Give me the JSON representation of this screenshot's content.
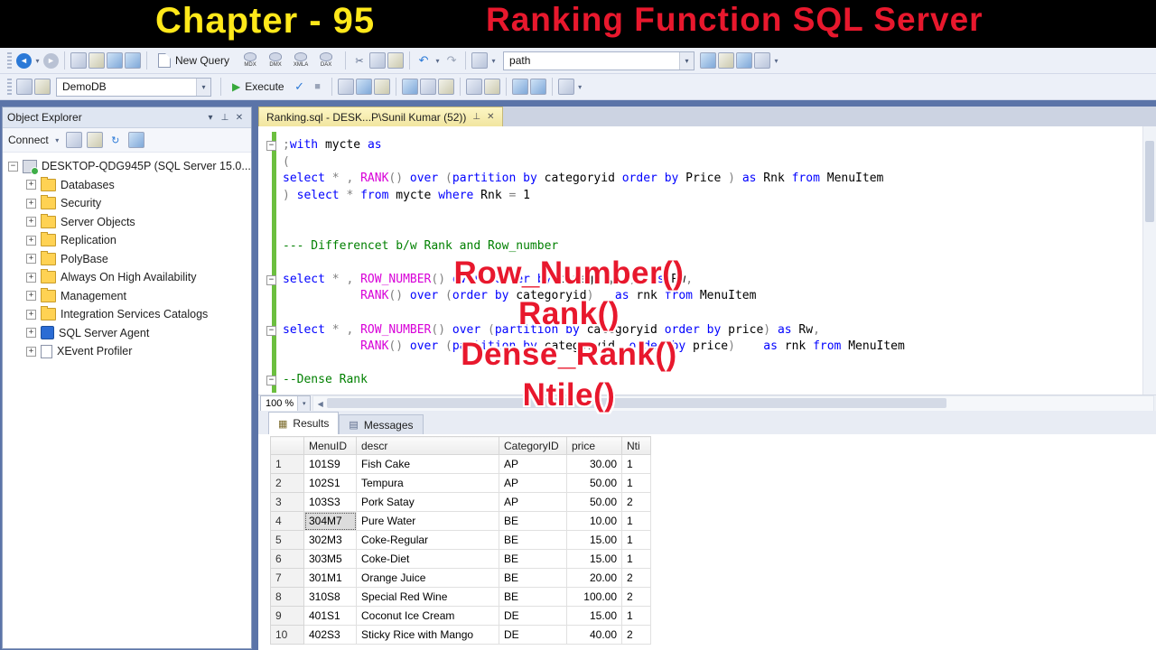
{
  "banner": {
    "chapter": "Chapter - 95",
    "title": "Ranking Function SQL Server",
    "chapter_color": "#ffe81a",
    "title_color": "#e8182d"
  },
  "toolbar": {
    "new_query_label": "New Query",
    "query_type_labels": [
      "MDX",
      "DMX",
      "XMLA",
      "DAX"
    ],
    "path_value": "path",
    "database_value": "DemoDB",
    "execute_label": "Execute"
  },
  "icons": {
    "back": "◄",
    "forward": "►",
    "dropdown": "▾",
    "cut": "✂",
    "undo": "↶",
    "redo": "↷",
    "refresh": "↻",
    "check": "✓",
    "stop": "■",
    "execute": "▶",
    "close": "✕",
    "pin": "⊥",
    "scroll_left": "◀",
    "results_grid": "▦",
    "messages": "▤",
    "expand_plus": "+",
    "expand_minus": "−",
    "fold_minus": "−",
    "menu_chev": "▾"
  },
  "object_explorer": {
    "title": "Object Explorer",
    "connect_label": "Connect",
    "root_label": "DESKTOP-QDG945P (SQL Server 15.0...",
    "items": [
      {
        "label": "Databases",
        "icon": "folder"
      },
      {
        "label": "Security",
        "icon": "folder"
      },
      {
        "label": "Server Objects",
        "icon": "folder"
      },
      {
        "label": "Replication",
        "icon": "folder"
      },
      {
        "label": "PolyBase",
        "icon": "folder"
      },
      {
        "label": "Always On High Availability",
        "icon": "folder"
      },
      {
        "label": "Management",
        "icon": "folder"
      },
      {
        "label": "Integration Services Catalogs",
        "icon": "folder"
      },
      {
        "label": "SQL Server Agent",
        "icon": "agent"
      },
      {
        "label": "XEvent Profiler",
        "icon": "profiler"
      }
    ]
  },
  "editor": {
    "tab_title": "Ranking.sql - DESK...P\\Sunil Kumar (52))",
    "zoom_value": "100 %",
    "code_lines": [
      {
        "fold": true,
        "tokens": [
          [
            "o",
            ";"
          ],
          [
            "k",
            "with"
          ],
          [
            "t",
            " mycte "
          ],
          [
            "k",
            "as"
          ]
        ]
      },
      {
        "tokens": [
          [
            "o",
            "("
          ]
        ]
      },
      {
        "tokens": [
          [
            "k",
            "select"
          ],
          [
            "o",
            " * , "
          ],
          [
            "f",
            "RANK"
          ],
          [
            "o",
            "() "
          ],
          [
            "k",
            "over"
          ],
          [
            "o",
            " ("
          ],
          [
            "k",
            "partition"
          ],
          [
            "t",
            " "
          ],
          [
            "k",
            "by"
          ],
          [
            "t",
            " categoryid "
          ],
          [
            "k",
            "order"
          ],
          [
            "t",
            " "
          ],
          [
            "k",
            "by"
          ],
          [
            "t",
            " Price "
          ],
          [
            "o",
            ") "
          ],
          [
            "k",
            "as"
          ],
          [
            "t",
            " Rnk "
          ],
          [
            "k",
            "from"
          ],
          [
            "t",
            " MenuItem"
          ]
        ]
      },
      {
        "tokens": [
          [
            "o",
            ") "
          ],
          [
            "k",
            "select"
          ],
          [
            "o",
            " * "
          ],
          [
            "k",
            "from"
          ],
          [
            "t",
            " mycte "
          ],
          [
            "k",
            "where"
          ],
          [
            "t",
            " Rnk "
          ],
          [
            "o",
            "= "
          ],
          [
            "t",
            "1"
          ]
        ]
      },
      {
        "tokens": []
      },
      {
        "tokens": []
      },
      {
        "tokens": [
          [
            "c",
            "--- Differencet b/w Rank and Row_number"
          ]
        ]
      },
      {
        "tokens": []
      },
      {
        "fold": true,
        "tokens": [
          [
            "k",
            "select"
          ],
          [
            "o",
            " * , "
          ],
          [
            "f",
            "ROW_NUMBER"
          ],
          [
            "o",
            "() "
          ],
          [
            "k",
            "over"
          ],
          [
            "o",
            " ("
          ],
          [
            "k",
            "order"
          ],
          [
            "t",
            " "
          ],
          [
            "k",
            "by"
          ],
          [
            "t",
            " categoryid"
          ],
          [
            "o",
            ")  "
          ],
          [
            "k",
            "as"
          ],
          [
            "t",
            " Rw"
          ],
          [
            "o",
            ","
          ]
        ]
      },
      {
        "tokens": [
          [
            "t",
            "           "
          ],
          [
            "f",
            "RANK"
          ],
          [
            "o",
            "() "
          ],
          [
            "k",
            "over"
          ],
          [
            "o",
            " ("
          ],
          [
            "k",
            "order"
          ],
          [
            "t",
            " "
          ],
          [
            "k",
            "by"
          ],
          [
            "t",
            " categoryid"
          ],
          [
            "o",
            ")   "
          ],
          [
            "k",
            "as"
          ],
          [
            "t",
            " rnk "
          ],
          [
            "k",
            "from"
          ],
          [
            "t",
            " MenuItem"
          ]
        ]
      },
      {
        "tokens": []
      },
      {
        "fold": true,
        "tokens": [
          [
            "k",
            "select"
          ],
          [
            "o",
            " * , "
          ],
          [
            "f",
            "ROW_NUMBER"
          ],
          [
            "o",
            "() "
          ],
          [
            "k",
            "over"
          ],
          [
            "o",
            " ("
          ],
          [
            "k",
            "partition"
          ],
          [
            "t",
            " "
          ],
          [
            "k",
            "by"
          ],
          [
            "t",
            " categoryid "
          ],
          [
            "k",
            "order"
          ],
          [
            "t",
            " "
          ],
          [
            "k",
            "by"
          ],
          [
            "t",
            " price"
          ],
          [
            "o",
            ") "
          ],
          [
            "k",
            "as"
          ],
          [
            "t",
            " Rw"
          ],
          [
            "o",
            ","
          ]
        ]
      },
      {
        "tokens": [
          [
            "t",
            "           "
          ],
          [
            "f",
            "RANK"
          ],
          [
            "o",
            "() "
          ],
          [
            "k",
            "over"
          ],
          [
            "o",
            " ("
          ],
          [
            "k",
            "partition"
          ],
          [
            "t",
            " "
          ],
          [
            "k",
            "by"
          ],
          [
            "t",
            " categoryid  "
          ],
          [
            "k",
            "order"
          ],
          [
            "t",
            " "
          ],
          [
            "k",
            "by"
          ],
          [
            "t",
            " price"
          ],
          [
            "o",
            ")    "
          ],
          [
            "k",
            "as"
          ],
          [
            "t",
            " rnk "
          ],
          [
            "k",
            "from"
          ],
          [
            "t",
            " MenuItem"
          ]
        ]
      },
      {
        "tokens": []
      },
      {
        "fold": true,
        "tokens": [
          [
            "c",
            "--Dense Rank"
          ]
        ]
      }
    ]
  },
  "annotations": {
    "color": "#e8182d",
    "lines": [
      "Row_Number()",
      "Rank()",
      "Dense_Rank()",
      "Ntile()"
    ]
  },
  "results": {
    "tab_results": "Results",
    "tab_messages": "Messages",
    "columns": [
      "MenuID",
      "descr",
      "CategoryID",
      "price",
      "Nti"
    ],
    "focus_cell": {
      "row": 3,
      "col": 0
    },
    "rows": [
      {
        "n": "1",
        "cells": [
          "101S9",
          "Fish Cake",
          "AP",
          "30.00",
          "1"
        ]
      },
      {
        "n": "2",
        "cells": [
          "102S1",
          "Tempura",
          "AP",
          "50.00",
          "1"
        ]
      },
      {
        "n": "3",
        "cells": [
          "103S3",
          "Pork Satay",
          "AP",
          "50.00",
          "2"
        ]
      },
      {
        "n": "4",
        "cells": [
          "304M7",
          "Pure Water",
          "BE",
          "10.00",
          "1"
        ]
      },
      {
        "n": "5",
        "cells": [
          "302M3",
          "Coke-Regular",
          "BE",
          "15.00",
          "1"
        ]
      },
      {
        "n": "6",
        "cells": [
          "303M5",
          "Coke-Diet",
          "BE",
          "15.00",
          "1"
        ]
      },
      {
        "n": "7",
        "cells": [
          "301M1",
          "Orange Juice",
          "BE",
          "20.00",
          "2"
        ]
      },
      {
        "n": "8",
        "cells": [
          "310S8",
          "Special Red Wine",
          "BE",
          "100.00",
          "2"
        ]
      },
      {
        "n": "9",
        "cells": [
          "401S1",
          "Coconut Ice Cream",
          "DE",
          "15.00",
          "1"
        ]
      },
      {
        "n": "10",
        "cells": [
          "402S3",
          "Sticky Rice with Mango",
          "DE",
          "40.00",
          "2"
        ]
      }
    ]
  }
}
